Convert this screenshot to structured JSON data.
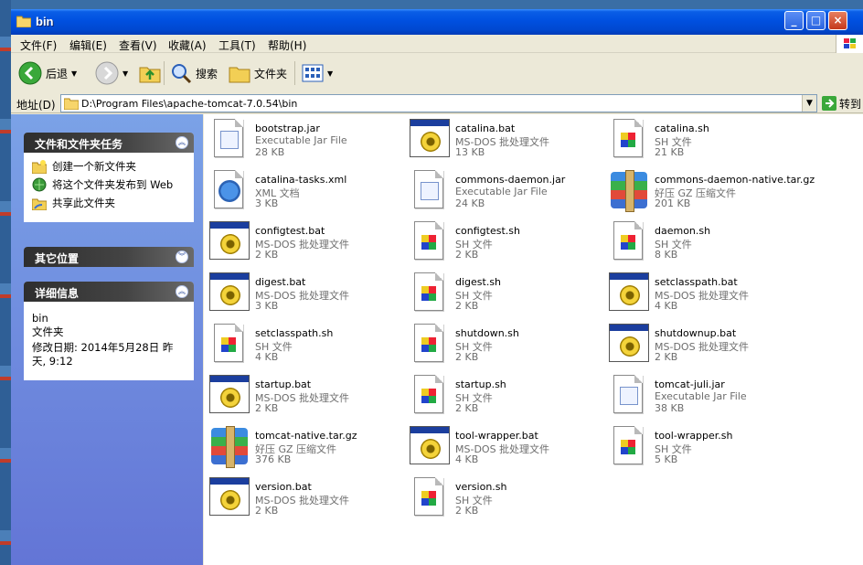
{
  "window": {
    "title": "bin"
  },
  "menu": [
    "文件(F)",
    "编辑(E)",
    "查看(V)",
    "收藏(A)",
    "工具(T)",
    "帮助(H)"
  ],
  "toolbar": {
    "back": "后退",
    "search": "搜索",
    "folders": "文件夹"
  },
  "address": {
    "label": "地址(D)",
    "path": "D:\\Program Files\\apache-tomcat-7.0.54\\bin",
    "go": "转到"
  },
  "tasks_panel": {
    "title": "文件和文件夹任务",
    "items": [
      "创建一个新文件夹",
      "将这个文件夹发布到 Web",
      "共享此文件夹"
    ]
  },
  "other_panel": {
    "title": "其它位置"
  },
  "details_panel": {
    "title": "详细信息",
    "name": "bin",
    "kind": "文件夹",
    "modified": "修改日期: 2014年5月28日 昨天, 9:12"
  },
  "files": [
    {
      "name": "bootstrap.jar",
      "type": "Executable Jar File",
      "size": "28 KB",
      "icon": "jar-icon"
    },
    {
      "name": "catalina.bat",
      "type": "MS-DOS 批处理文件",
      "size": "13 KB",
      "icon": "bat-icon"
    },
    {
      "name": "catalina.sh",
      "type": "SH 文件",
      "size": "21 KB",
      "icon": "sh-icon"
    },
    {
      "name": "catalina-tasks.xml",
      "type": "XML 文档",
      "size": "3 KB",
      "icon": "xml-icon"
    },
    {
      "name": "commons-daemon.jar",
      "type": "Executable Jar File",
      "size": "24 KB",
      "icon": "jar-icon"
    },
    {
      "name": "commons-daemon-native.tar.gz",
      "type": "好压 GZ 压缩文件",
      "size": "201 KB",
      "icon": "archive-icon"
    },
    {
      "name": "configtest.bat",
      "type": "MS-DOS 批处理文件",
      "size": "2 KB",
      "icon": "bat-icon"
    },
    {
      "name": "configtest.sh",
      "type": "SH 文件",
      "size": "2 KB",
      "icon": "sh-icon"
    },
    {
      "name": "daemon.sh",
      "type": "SH 文件",
      "size": "8 KB",
      "icon": "sh-icon"
    },
    {
      "name": "digest.bat",
      "type": "MS-DOS 批处理文件",
      "size": "3 KB",
      "icon": "bat-icon"
    },
    {
      "name": "digest.sh",
      "type": "SH 文件",
      "size": "2 KB",
      "icon": "sh-icon"
    },
    {
      "name": "setclasspath.bat",
      "type": "MS-DOS 批处理文件",
      "size": "4 KB",
      "icon": "bat-icon"
    },
    {
      "name": "setclasspath.sh",
      "type": "SH 文件",
      "size": "4 KB",
      "icon": "sh-icon"
    },
    {
      "name": "shutdown.sh",
      "type": "SH 文件",
      "size": "2 KB",
      "icon": "sh-icon"
    },
    {
      "name": "shutdownup.bat",
      "type": "MS-DOS 批处理文件",
      "size": "2 KB",
      "icon": "bat-icon"
    },
    {
      "name": "startup.bat",
      "type": "MS-DOS 批处理文件",
      "size": "2 KB",
      "icon": "bat-icon"
    },
    {
      "name": "startup.sh",
      "type": "SH 文件",
      "size": "2 KB",
      "icon": "sh-icon"
    },
    {
      "name": "tomcat-juli.jar",
      "type": "Executable Jar File",
      "size": "38 KB",
      "icon": "jar-icon"
    },
    {
      "name": "tomcat-native.tar.gz",
      "type": "好压 GZ 压缩文件",
      "size": "376 KB",
      "icon": "archive-icon"
    },
    {
      "name": "tool-wrapper.bat",
      "type": "MS-DOS 批处理文件",
      "size": "4 KB",
      "icon": "bat-icon"
    },
    {
      "name": "tool-wrapper.sh",
      "type": "SH 文件",
      "size": "5 KB",
      "icon": "sh-icon"
    },
    {
      "name": "version.bat",
      "type": "MS-DOS 批处理文件",
      "size": "2 KB",
      "icon": "bat-icon"
    },
    {
      "name": "version.sh",
      "type": "SH 文件",
      "size": "2 KB",
      "icon": "sh-icon"
    }
  ],
  "colors": {
    "titlebar": "#0050e0",
    "sidepane": "#7ba2e7",
    "panel": "#d6dff7"
  }
}
